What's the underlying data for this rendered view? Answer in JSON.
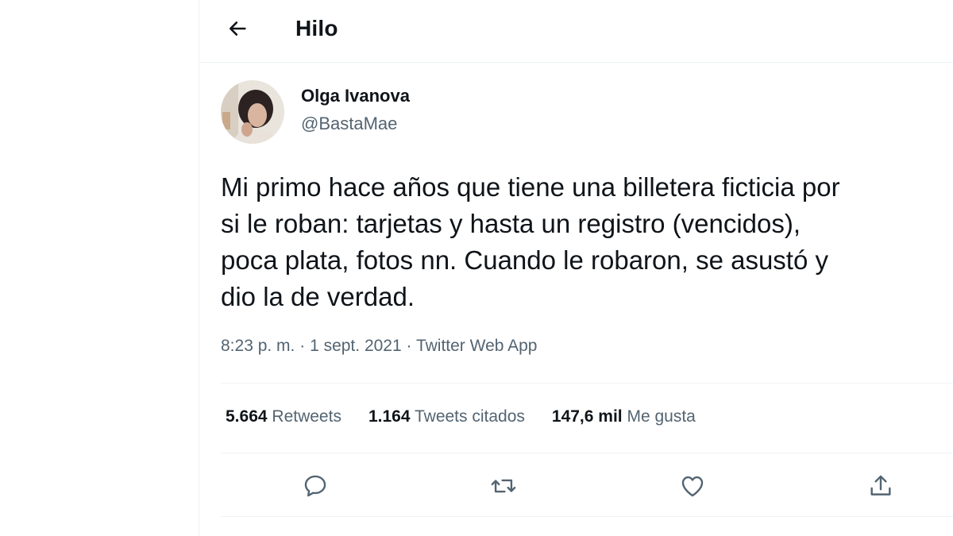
{
  "header": {
    "title": "Hilo",
    "back_icon": "arrow-left-icon"
  },
  "tweet": {
    "author": {
      "name": "Olga Ivanova",
      "handle": "@BastaMae"
    },
    "text": "Mi primo hace años que tiene una billetera ficticia por\nsi le roban: tarjetas y hasta un registro (vencidos),\npoca plata, fotos nn. Cuando le robaron, se asustó y\ndio la de verdad.",
    "time": "8:23 p. m.",
    "separator": " · ",
    "date": "1 sept. 2021",
    "source": "Twitter Web App",
    "stats": {
      "retweets_count": "5.664",
      "retweets_label": "Retweets",
      "quotes_count": "1.164",
      "quotes_label": "Tweets citados",
      "likes_count": "147,6 mil",
      "likes_label": "Me gusta"
    },
    "actions": [
      "reply-icon",
      "retweet-icon",
      "like-icon",
      "share-icon"
    ]
  },
  "colors": {
    "text_primary": "#0f1419",
    "text_secondary": "#536471",
    "divider": "#eff3f4"
  }
}
